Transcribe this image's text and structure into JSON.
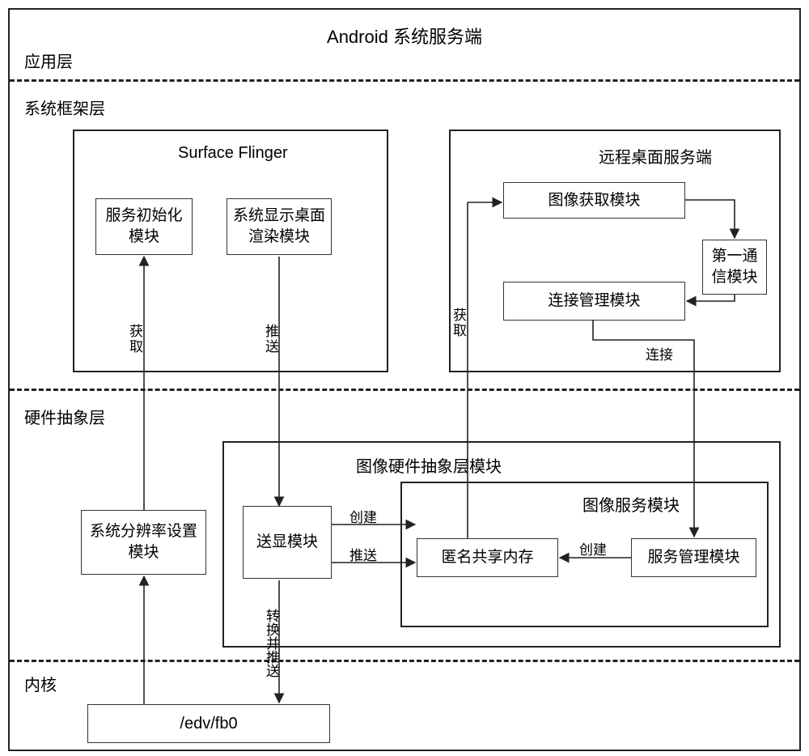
{
  "title": "Android 系统服务端",
  "layers": {
    "app": "应用层",
    "framework": "系统框架层",
    "hal": "硬件抽象层",
    "kernel": "内核"
  },
  "framework": {
    "surfaceFlinger": {
      "title": "Surface Flinger",
      "initModule": "服务初始化模块",
      "renderModule": "系统显示桌面渲染模块"
    },
    "remoteDesktop": {
      "title": "远程桌面服务端",
      "imageAcquire": "图像获取模块",
      "firstComm": "第一通信模块",
      "connectionMgr": "连接管理模块"
    }
  },
  "hal": {
    "resolutionModule": "系统分辨率设置模块",
    "imageHalTitle": "图像硬件抽象层模块",
    "displayModule": "送显模块",
    "imageService": {
      "title": "图像服务模块",
      "anonSharedMem": "匿名共享内存",
      "serviceMgr": "服务管理模块"
    }
  },
  "kernel": {
    "fb": "/edv/fb0"
  },
  "edgeLabels": {
    "acquire": "获取",
    "push": "推送",
    "create": "创建",
    "connect": "连接",
    "convertPush": "转换并推送"
  }
}
